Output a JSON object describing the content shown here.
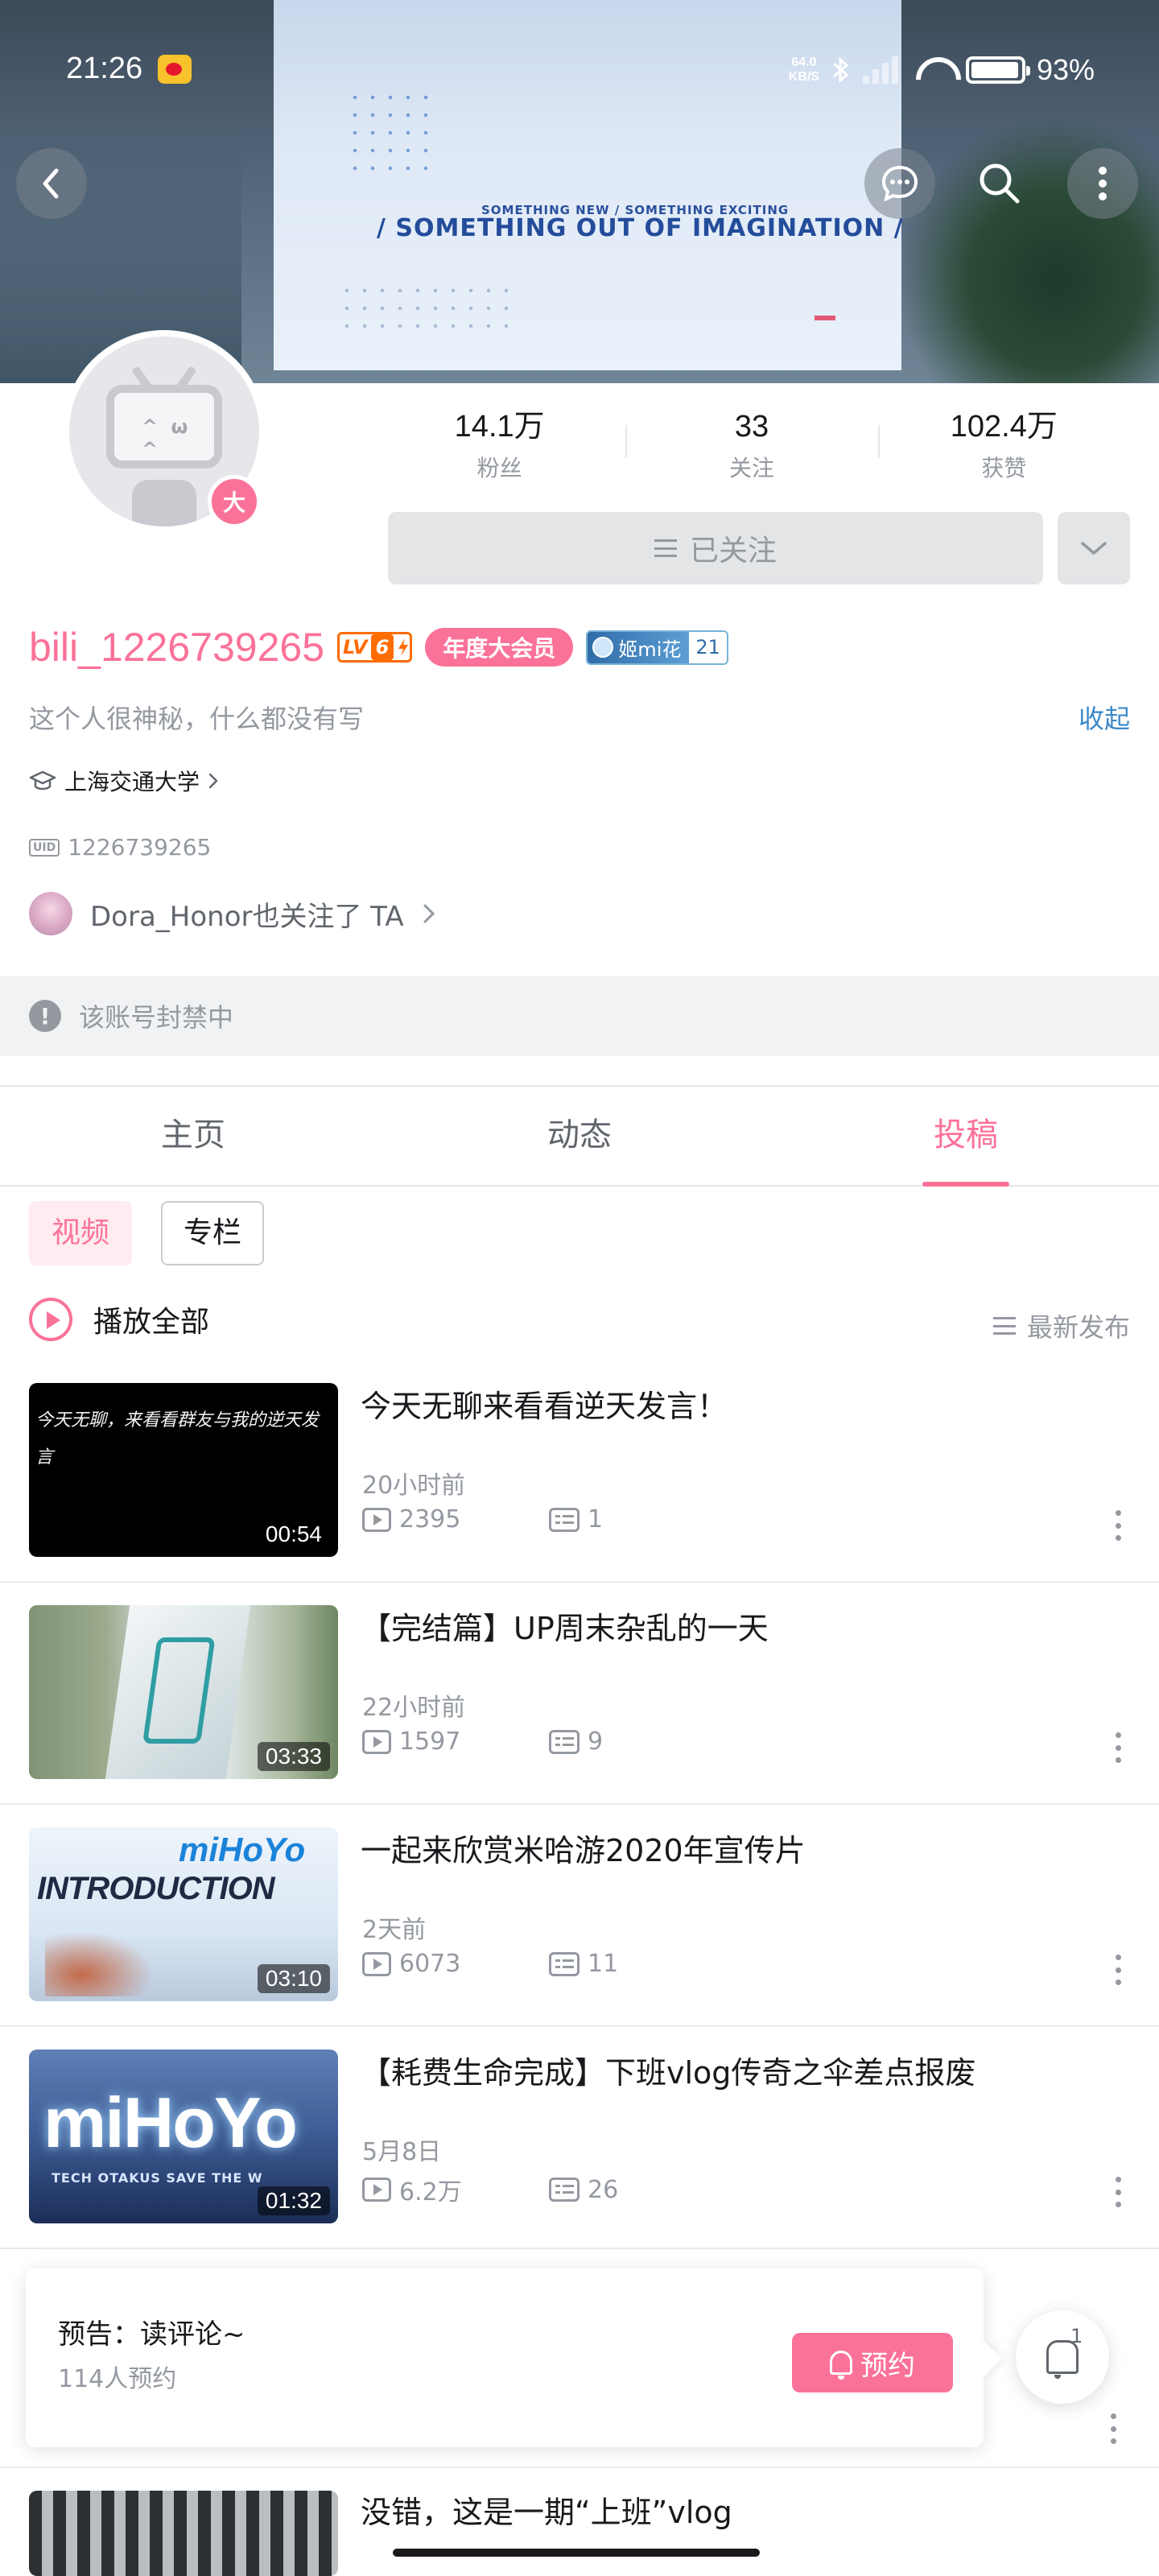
{
  "status_bar": {
    "time": "21:26",
    "net_speed_value": "64.0",
    "net_speed_unit": "KB/S",
    "battery": "93%",
    "icons": [
      "weibo-icon",
      "bluetooth-icon",
      "signal-icon",
      "wifi-icon",
      "battery-icon"
    ]
  },
  "banner": {
    "small_text": "SOMETHING NEW / SOMETHING EXCITING",
    "big_text": "/ SOMETHING OUT OF IMAGINATION /"
  },
  "profile": {
    "avatar_badge": "大",
    "stats": [
      {
        "value": "14.1万",
        "label": "粉丝"
      },
      {
        "value": "33",
        "label": "关注"
      },
      {
        "value": "102.4万",
        "label": "获赞"
      }
    ],
    "follow_button": "已关注",
    "username": "bili_1226739265",
    "level_text": "LV",
    "level_num": "6",
    "vip_badge": "年度大会员",
    "medal_name": "姬mi花",
    "medal_level": "21",
    "bio": "这个人很神秘，什么都没有写",
    "collapse_link": "收起",
    "school": "上海交通大学",
    "uid_tag": "UID",
    "uid": "1226739265",
    "mutual_follow": "Dora_Honor也关注了 TA"
  },
  "ban_notice": "该账号封禁中",
  "tabs": [
    {
      "label": "主页",
      "active": false
    },
    {
      "label": "动态",
      "active": false
    },
    {
      "label": "投稿",
      "active": true
    }
  ],
  "subtabs": [
    {
      "label": "视频",
      "active": true
    },
    {
      "label": "专栏",
      "active": false
    }
  ],
  "play_all": "播放全部",
  "sort_label": "最新发布",
  "videos": [
    {
      "title": "今天无聊来看看逆天发言！",
      "time": "20小时前",
      "plays": "2395",
      "danmaku": "1",
      "duration": "00:54",
      "thumb_text": "今天无聊，来看看群友与我的逆天发言"
    },
    {
      "title": "【完结篇】UP周末杂乱的一天",
      "time": "22小时前",
      "plays": "1597",
      "danmaku": "9",
      "duration": "03:33"
    },
    {
      "title": "一起来欣赏米哈游2020年宣传片",
      "time": "2天前",
      "plays": "6073",
      "danmaku": "11",
      "duration": "03:10",
      "thumb_brand": "miHoYo",
      "thumb_text": "INTRODUCTION"
    },
    {
      "title": "【耗费生命完成】下班vlog传奇之伞差点报废",
      "time": "5月8日",
      "plays": "6.2万",
      "danmaku": "26",
      "duration": "01:32",
      "thumb_brand": "miHoYo",
      "thumb_text": "TECH OTAKUS SAVE THE W"
    },
    {
      "title": "没错，这是一期“上班”vlog"
    }
  ],
  "reservation": {
    "title": "预告：读评论~",
    "count": "114人预约",
    "button": "预约",
    "bell_count": "1"
  },
  "colors": {
    "accent": "#fb7299",
    "link": "#3b89c9",
    "muted": "#9499a0"
  }
}
